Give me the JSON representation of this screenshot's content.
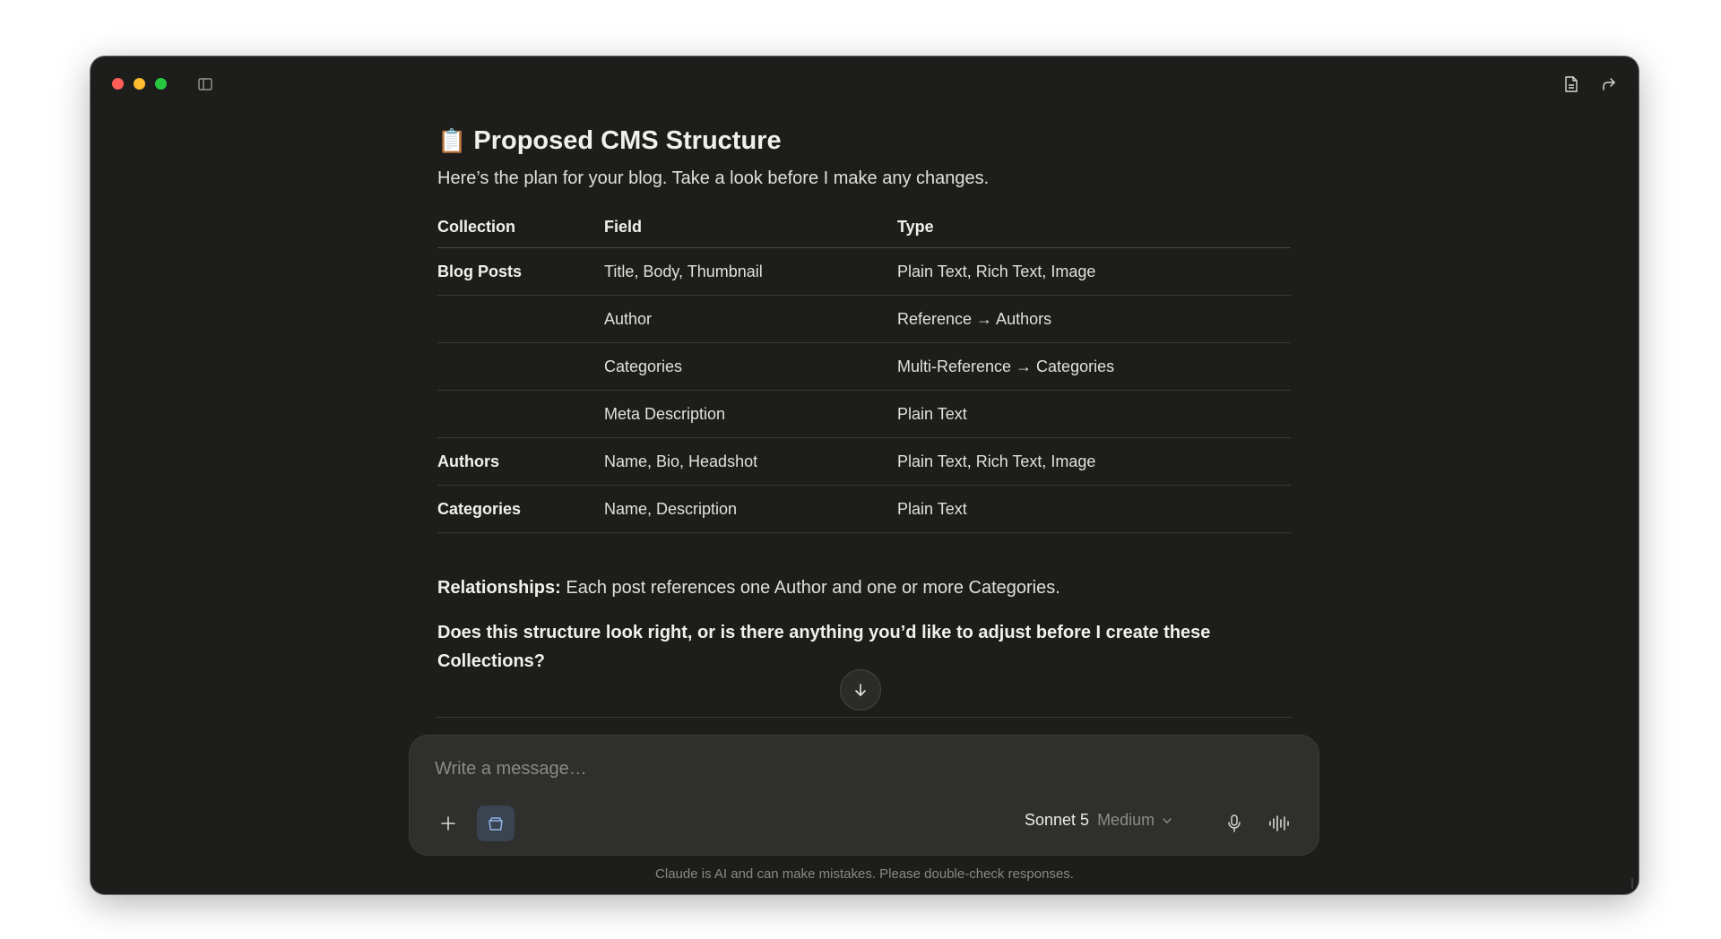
{
  "window": {
    "traffic_lights": [
      "close",
      "minimize",
      "maximize"
    ],
    "icons": {
      "sidebar_toggle": "sidebar-toggle-icon",
      "document": "document-icon",
      "share": "share-icon"
    }
  },
  "message": {
    "title_emoji": "📋",
    "title": "Proposed CMS Structure",
    "intro": "Here’s the plan for your blog. Take a look before I make any changes.",
    "table": {
      "headers": [
        "Collection",
        "Field",
        "Type"
      ],
      "rows": [
        {
          "collection": "Blog Posts",
          "field": "Title, Body, Thumbnail",
          "type": "Plain Text, Rich Text, Image"
        },
        {
          "collection": "",
          "field": "Author",
          "type": "Reference → Authors"
        },
        {
          "collection": "",
          "field": "Categories",
          "type": "Multi-Reference → Categories"
        },
        {
          "collection": "",
          "field": "Meta Description",
          "type": "Plain Text"
        },
        {
          "collection": "Authors",
          "field": "Name, Bio, Headshot",
          "type": "Plain Text, Rich Text, Image"
        },
        {
          "collection": "Categories",
          "field": "Name, Description",
          "type": "Plain Text"
        }
      ]
    },
    "relationships_label": "Relationships:",
    "relationships_text": " Each post references one Author and one or more Categories.",
    "question": "Does this structure look right, or is there anything you’d like to adjust before I create these Collections?"
  },
  "composer": {
    "placeholder": "Write a message…",
    "model_name": "Sonnet 5",
    "model_effort": "Medium"
  },
  "disclaimer": "Claude is AI and can make mistakes. Please double-check responses.",
  "colors": {
    "window_bg": "#1d1d1c",
    "composer_bg": "#2f2f2d",
    "tool_active_bg": "#3a4350",
    "close": "#fe5f57",
    "minimize": "#febc2e",
    "maximize": "#28c840"
  }
}
